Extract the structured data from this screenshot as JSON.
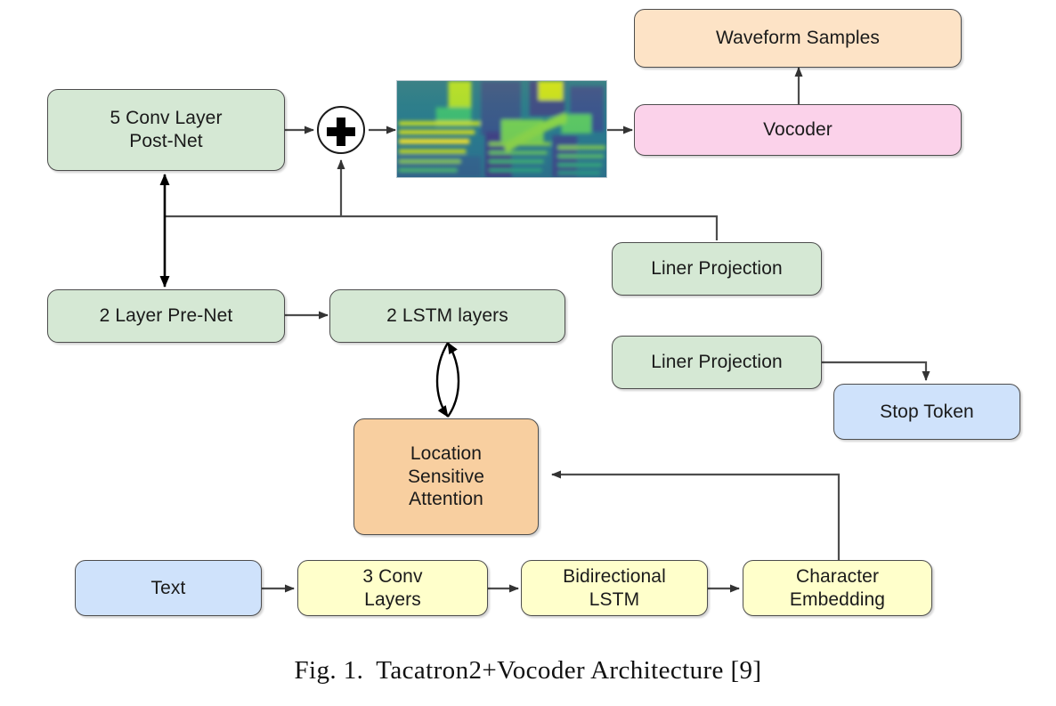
{
  "figure": {
    "caption_label": "Fig. 1.",
    "caption_text": "Tacatron2+Vocoder Architecture [9]",
    "caption_full": "Fig. 1.  Tacatron2+Vocoder Architecture [9]"
  },
  "palette": {
    "green": "#d5e8d4",
    "orange": "#f8cfa0",
    "peach": "#fde3c6",
    "pink": "#fbd2ea",
    "blue": "#cfe2fb",
    "yellow": "#ffffcb",
    "border": "#4d4d4d",
    "wire": "#4d4d4d",
    "text": "#1a1a1a"
  },
  "nodes": {
    "post_net": {
      "label": "5 Conv Layer\nPost-Net",
      "color": "green"
    },
    "sum": {
      "label": "+",
      "icon": "plus-circle-icon"
    },
    "spectrogram": {
      "label": "mel-spectrogram-image",
      "colormap": "viridis"
    },
    "vocoder": {
      "label": "Vocoder",
      "color": "pink"
    },
    "waveform_samples": {
      "label": "Waveform Samples",
      "color": "peach"
    },
    "pre_net": {
      "label": "2 Layer Pre-Net",
      "color": "green"
    },
    "lstm_layers": {
      "label": "2 LSTM layers",
      "color": "green"
    },
    "linear_projection_top": {
      "label": "Liner Projection",
      "color": "green"
    },
    "linear_projection_bottom": {
      "label": "Liner Projection",
      "color": "green"
    },
    "stop_token": {
      "label": "Stop Token",
      "color": "blue"
    },
    "attention": {
      "label": "Location\nSensitive\nAttention",
      "color": "orange"
    },
    "text_input": {
      "label": "Text",
      "color": "blue"
    },
    "conv_layers": {
      "label": "3 Conv\nLayers",
      "color": "yellow"
    },
    "bidirectional_lstm": {
      "label": "Bidirectional\nLSTM",
      "color": "yellow"
    },
    "character_embedding": {
      "label": "Character\nEmbedding",
      "color": "yellow"
    }
  },
  "edges": [
    {
      "name": "postnet-to-sum",
      "from": "post_net",
      "to": "sum",
      "arrow": "single"
    },
    {
      "name": "sum-to-spectrogram",
      "from": "sum",
      "to": "spectrogram",
      "arrow": "single"
    },
    {
      "name": "spectrogram-to-vocoder",
      "from": "spectrogram",
      "to": "vocoder",
      "arrow": "single"
    },
    {
      "name": "vocoder-to-waveform",
      "from": "vocoder",
      "to": "waveform_samples",
      "arrow": "single"
    },
    {
      "name": "projection-bus-to-sum",
      "from": "linear_projection_top",
      "to": "sum",
      "arrow": "single"
    },
    {
      "name": "projection-bus-to-postnet",
      "from": "linear_projection_top",
      "to": "post_net",
      "arrow": "single"
    },
    {
      "name": "postnet-prenet-bidirectional",
      "from": "post_net",
      "to": "pre_net",
      "arrow": "double"
    },
    {
      "name": "prenet-to-lstm",
      "from": "pre_net",
      "to": "lstm_layers",
      "arrow": "single"
    },
    {
      "name": "lstm-attention-bidirectional",
      "from": "lstm_layers",
      "to": "attention",
      "arrow": "double-curved"
    },
    {
      "name": "projection-to-stop-token",
      "from": "linear_projection_bottom",
      "to": "stop_token",
      "arrow": "single"
    },
    {
      "name": "embedding-to-attention",
      "from": "character_embedding",
      "to": "attention",
      "arrow": "single"
    },
    {
      "name": "text-to-conv",
      "from": "text_input",
      "to": "conv_layers",
      "arrow": "single"
    },
    {
      "name": "conv-to-bilstm",
      "from": "conv_layers",
      "to": "bidirectional_lstm",
      "arrow": "single"
    },
    {
      "name": "bilstm-to-embedding",
      "from": "bidirectional_lstm",
      "to": "character_embedding",
      "arrow": "single"
    }
  ]
}
